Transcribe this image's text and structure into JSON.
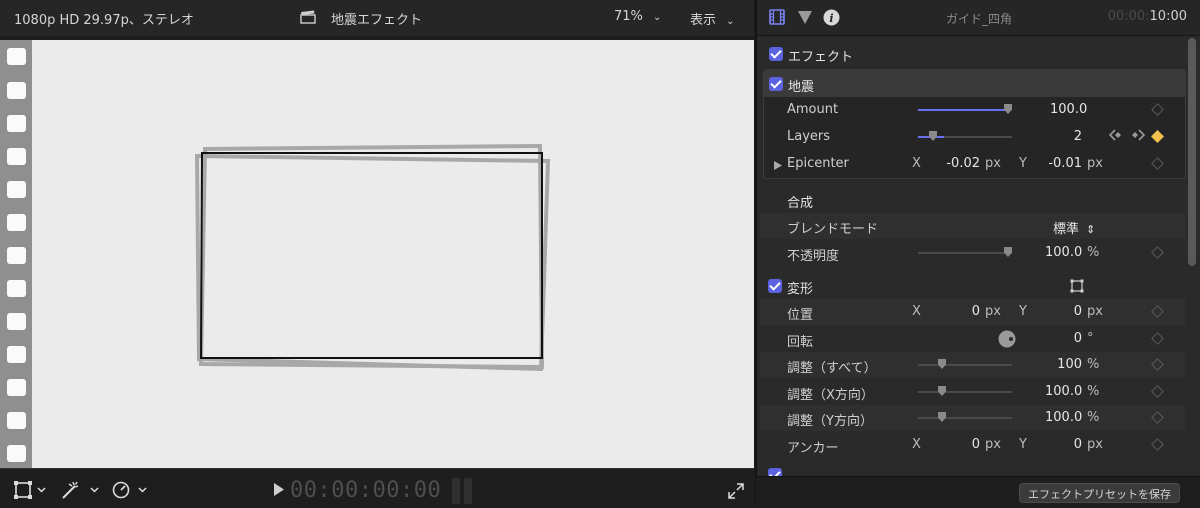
{
  "viewer": {
    "format_label": "1080p HD 29.97p、ステレオ",
    "clip_title": "地震エフェクト",
    "zoom": "71%",
    "display_menu": "表示",
    "timecode": "00:00:00:00"
  },
  "inspector": {
    "title": "ガイド_四角",
    "time_dim": "00:00:",
    "time_bright": "10:00",
    "effects_section": "エフェクト",
    "effect_name": "地震",
    "amount": {
      "label": "Amount",
      "value": "100.0",
      "fraction": 1.0
    },
    "layers": {
      "label": "Layers",
      "value": "2",
      "fraction": 0.17
    },
    "epicenter": {
      "label": "Epicenter",
      "x_axis": "X",
      "x": "-0.02",
      "x_unit": "px",
      "y_axis": "Y",
      "y": "-0.01",
      "y_unit": "px"
    },
    "composite": {
      "section": "合成",
      "blend_label": "ブレンドモード",
      "blend_value": "標準",
      "opacity_label": "不透明度",
      "opacity_value": "100.0",
      "opacity_unit": "%",
      "opacity_fraction": 1.0
    },
    "transform": {
      "section": "変形",
      "position": {
        "label": "位置",
        "x_axis": "X",
        "x": "0",
        "x_unit": "px",
        "y_axis": "Y",
        "y": "0",
        "y_unit": "px"
      },
      "rotation": {
        "label": "回転",
        "value": "0",
        "unit": "°"
      },
      "scale_all": {
        "label": "調整（すべて）",
        "value": "100",
        "unit": "%",
        "fraction": 0.25
      },
      "scale_x": {
        "label": "調整（X方向）",
        "value": "100.0",
        "unit": "%",
        "fraction": 0.25
      },
      "scale_y": {
        "label": "調整（Y方向）",
        "value": "100.0",
        "unit": "%",
        "fraction": 0.25
      },
      "anchor": {
        "label": "アンカー",
        "x_axis": "X",
        "x": "0",
        "x_unit": "px",
        "y_axis": "Y",
        "y": "0",
        "y_unit": "px"
      }
    },
    "save_preset": "エフェクトプリセットを保存"
  },
  "colors": {
    "accent": "#5b63e0",
    "keyframe_active": "#f2c14e",
    "canvas": "#ebebeb"
  }
}
